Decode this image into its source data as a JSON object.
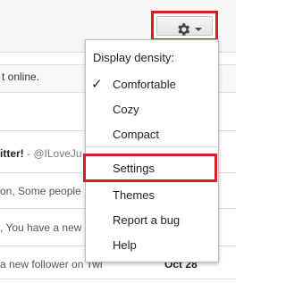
{
  "toolbar": {
    "settings_icon": "gear-icon",
    "highlight_color": "#d32027"
  },
  "background": {
    "notice_text": "t online.",
    "rows": [
      {
        "sender": "itter!",
        "snippet": " - @ILoveJu"
      },
      {
        "text": "on, Some people"
      },
      {
        "text": ", You have a new"
      },
      {
        "text": "a new follower on Twi",
        "date": "Oct 28"
      }
    ]
  },
  "menu": {
    "header": "Display density:",
    "density_options": [
      {
        "label": "Comfortable",
        "checked": true
      },
      {
        "label": "Cozy",
        "checked": false
      },
      {
        "label": "Compact",
        "checked": false
      }
    ],
    "actions": [
      {
        "label": "Settings",
        "highlighted": true
      },
      {
        "label": "Themes"
      },
      {
        "label": "Report a bug"
      },
      {
        "label": "Help"
      }
    ]
  }
}
